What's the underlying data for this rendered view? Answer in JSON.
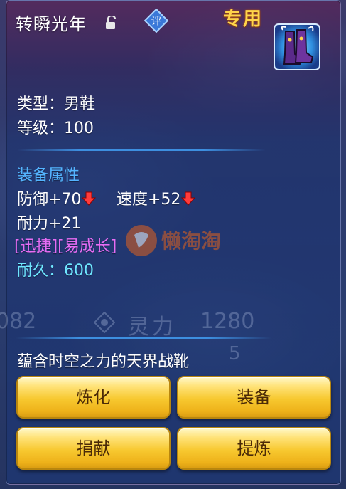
{
  "header": {
    "item_name": "转瞬光年",
    "review_badge": "评",
    "exclusive_label": "专用"
  },
  "info": {
    "type_line": "类型：男鞋",
    "level_line": "等级：100"
  },
  "attributes": {
    "section_title": "装备属性",
    "defense": "防御+70",
    "speed": "速度+52",
    "endurance": "耐力+21",
    "special_tags": "[迅捷][易成长]",
    "durability": "耐久：600"
  },
  "background": {
    "ghost_num_left": "082",
    "ghost_spirit": "灵力",
    "ghost_spirit_value": "1280",
    "ghost_num_right": "5"
  },
  "watermark": "懒淘淘",
  "description": "蕴含时空之力的天界战靴",
  "buttons": {
    "refine": "炼化",
    "equip": "装备",
    "donate": "捐献",
    "extract": "提炼"
  },
  "colors": {
    "section_title": "#54b4ff",
    "special_tags": "#e66df5",
    "durability": "#6fe7ff",
    "exclusive": "#ffd54a",
    "button": "#f7c82f",
    "down_arrow": "#ff3b3b"
  },
  "icons": {
    "lock": "unlocked-padlock-icon",
    "review": "review-badge-icon",
    "item": "boots-item-icon",
    "stat_down": "red-down-arrow-icon"
  }
}
